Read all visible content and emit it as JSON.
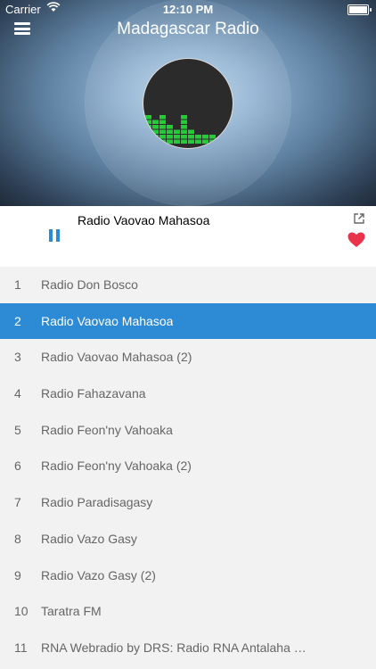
{
  "status_bar": {
    "carrier": "Carrier",
    "time": "12:10 PM"
  },
  "header": {
    "title": "Madagascar Radio"
  },
  "player": {
    "now_playing": "Radio Vaovao Mahasoa"
  },
  "stations": [
    {
      "num": "1",
      "name": "Radio Don Bosco"
    },
    {
      "num": "2",
      "name": "Radio Vaovao Mahasoa"
    },
    {
      "num": "3",
      "name": "Radio Vaovao Mahasoa (2)"
    },
    {
      "num": "4",
      "name": "Radio Fahazavana"
    },
    {
      "num": "5",
      "name": "Radio Feon'ny Vahoaka"
    },
    {
      "num": "6",
      "name": "Radio Feon'ny Vahoaka (2)"
    },
    {
      "num": "7",
      "name": "Radio Paradisagasy"
    },
    {
      "num": "8",
      "name": "Radio Vazo Gasy"
    },
    {
      "num": "9",
      "name": "Radio Vazo Gasy (2)"
    },
    {
      "num": "10",
      "name": "Taratra FM"
    },
    {
      "num": "11",
      "name": "RNA Webradio by DRS: Radio RNA Antalaha M..."
    }
  ],
  "colors": {
    "accent": "#2d8ad4",
    "heart": "#e8334a",
    "equalizer": "#22cc33"
  }
}
